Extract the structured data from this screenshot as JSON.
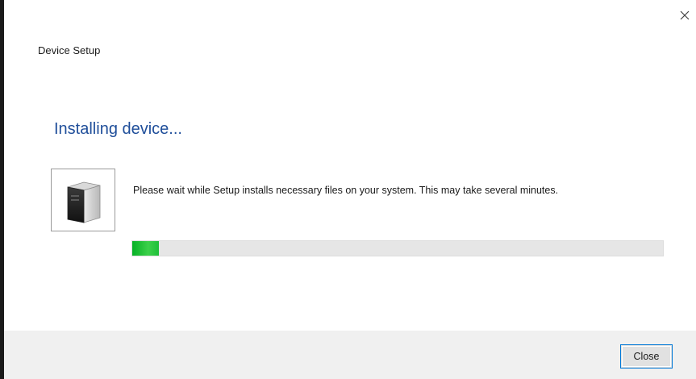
{
  "window": {
    "title": "Device Setup",
    "close_icon": "close-icon"
  },
  "main": {
    "heading": "Installing device...",
    "device_icon": "device-icon",
    "message": "Please wait while Setup installs necessary files on your system. This may take several minutes.",
    "progress": {
      "fraction": 0.05,
      "color": "#06b025"
    }
  },
  "footer": {
    "close_label": "Close"
  },
  "colors": {
    "heading": "#1f4e9a",
    "button_border": "#0078d7",
    "footer_bg": "#f0f0f0"
  }
}
